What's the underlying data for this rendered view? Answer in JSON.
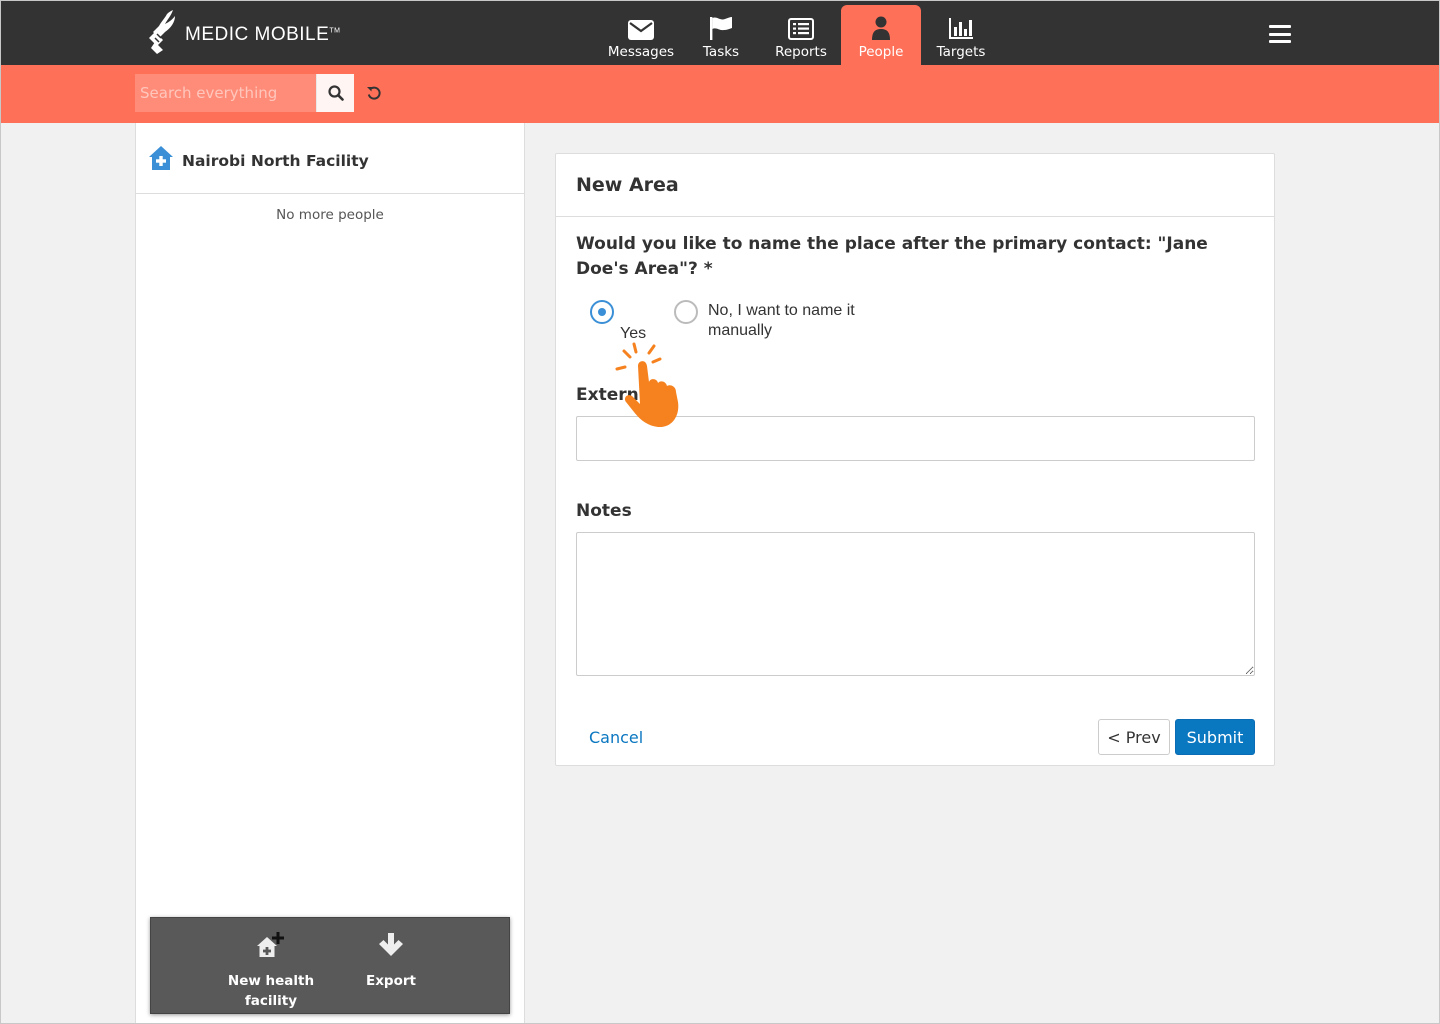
{
  "header": {
    "brand": "MEDIC MOBILE",
    "trademark": "TM",
    "nav": [
      {
        "label": "Messages",
        "icon": "envelope-icon"
      },
      {
        "label": "Tasks",
        "icon": "flag-icon"
      },
      {
        "label": "Reports",
        "icon": "list-icon"
      },
      {
        "label": "People",
        "icon": "person-icon",
        "active": true
      },
      {
        "label": "Targets",
        "icon": "bar-chart-icon"
      }
    ],
    "menu_icon": "hamburger-icon"
  },
  "search": {
    "placeholder": "Search everything",
    "value": ""
  },
  "sidebar": {
    "facility_name": "Nairobi North Facility",
    "no_more_text": "No more people",
    "actions": [
      {
        "label_line1": "New health",
        "label_line2": "facility",
        "icon": "add-facility-icon"
      },
      {
        "label": "Export",
        "icon": "download-arrow-icon"
      }
    ]
  },
  "form": {
    "title": "New Area",
    "question": "Would you like to name the place after the primary contact: \"Jane Doe's Area\"? *",
    "options": [
      {
        "label": "Yes",
        "checked": true
      },
      {
        "label_line1": "No, I want to name it",
        "label_line2": "manually",
        "checked": false
      }
    ],
    "external_label": "Extern",
    "external_value": "",
    "notes_label": "Notes",
    "notes_value": "",
    "cancel_label": "Cancel",
    "prev_label": "< Prev",
    "submit_label": "Submit"
  },
  "colors": {
    "topbar": "#333333",
    "accent": "#ff7059",
    "primary_button": "#0a77c1",
    "radio_selected": "#3a8fd6",
    "hand_pointer": "#f5821f"
  }
}
